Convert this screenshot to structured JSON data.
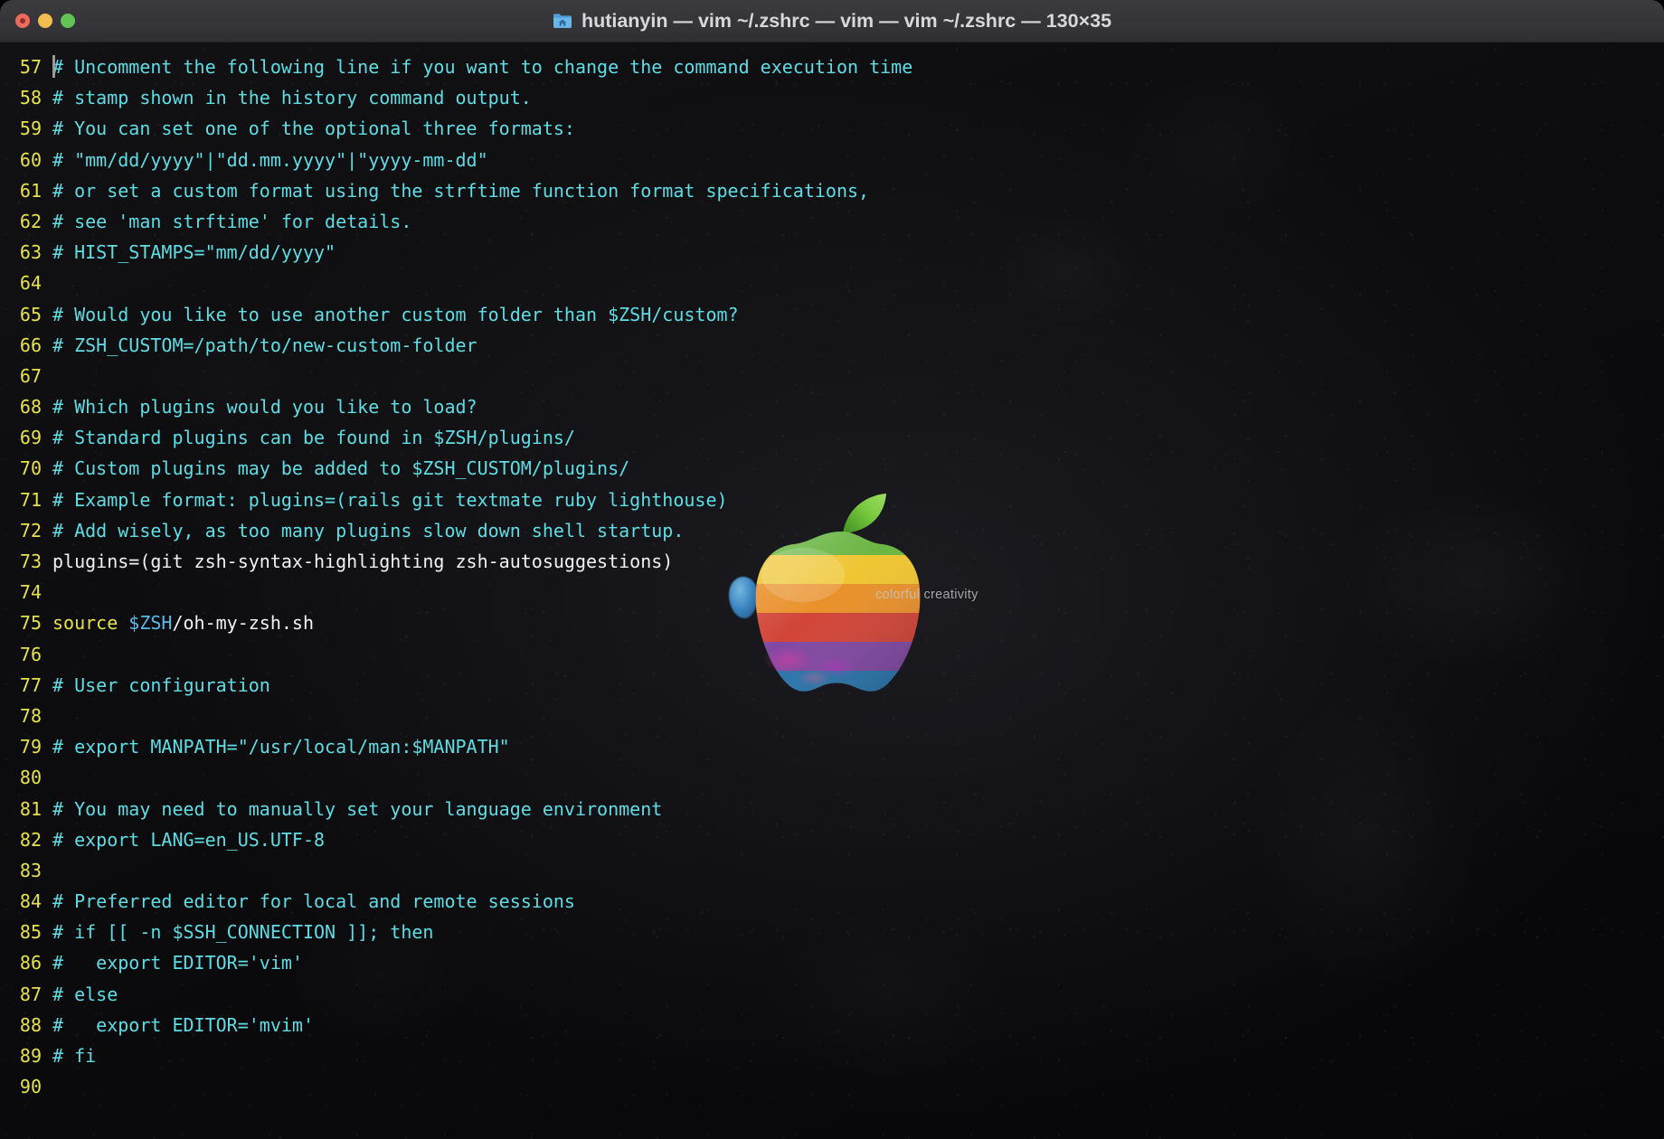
{
  "window": {
    "title": "hutianyin — vim ~/.zshrc — vim — vim ~/.zshrc — 130×35",
    "icon": "home-folder-icon",
    "traffic_lights": {
      "close_label": "Close",
      "minimize_label": "Minimize",
      "maximize_label": "Maximize",
      "close_color": "#ed6a5f",
      "minimize_color": "#f4bd4f",
      "maximize_color": "#61c454"
    }
  },
  "wallpaper": {
    "tagline": "colorful creativity",
    "logo": "apple-rainbow-logo",
    "background_color": "#0b0b0d",
    "stripe_colors": [
      "#63b23a",
      "#eec227",
      "#e88b20",
      "#cf3b2d",
      "#7b3f9e",
      "#1f6fa8"
    ]
  },
  "editor": {
    "app": "vim",
    "file": "~/.zshrc",
    "columns": 130,
    "rows": 35,
    "cursor": {
      "line": 57,
      "col": 1
    },
    "colors": {
      "line_number": "#e6e14f",
      "comment": "#5fdde5",
      "normal_text": "#f2f2f2",
      "keyword": "#e6e14f",
      "variable": "#5ab9e8",
      "cursor": "#9a9a9a"
    },
    "lines": [
      {
        "n": "57",
        "cursor": true,
        "spans": [
          {
            "c": "txt",
            "t": "# Uncomment the following line if you want to change the command execution time"
          }
        ]
      },
      {
        "n": "58",
        "spans": [
          {
            "c": "txt",
            "t": "# stamp shown in the history command output."
          }
        ]
      },
      {
        "n": "59",
        "spans": [
          {
            "c": "txt",
            "t": "# You can set one of the optional three formats:"
          }
        ]
      },
      {
        "n": "60",
        "spans": [
          {
            "c": "txt",
            "t": "# \"mm/dd/yyyy\"|\"dd.mm.yyyy\"|\"yyyy-mm-dd\""
          }
        ]
      },
      {
        "n": "61",
        "spans": [
          {
            "c": "txt",
            "t": "# or set a custom format using the strftime function format specifications,"
          }
        ]
      },
      {
        "n": "62",
        "spans": [
          {
            "c": "txt",
            "t": "# see 'man strftime' for details."
          }
        ]
      },
      {
        "n": "63",
        "spans": [
          {
            "c": "txt",
            "t": "# HIST_STAMPS=\"mm/dd/yyyy\""
          }
        ]
      },
      {
        "n": "64",
        "spans": []
      },
      {
        "n": "65",
        "spans": [
          {
            "c": "txt",
            "t": "# Would you like to use another custom folder than $ZSH/custom?"
          }
        ]
      },
      {
        "n": "66",
        "spans": [
          {
            "c": "txt",
            "t": "# ZSH_CUSTOM=/path/to/new-custom-folder"
          }
        ]
      },
      {
        "n": "67",
        "spans": []
      },
      {
        "n": "68",
        "spans": [
          {
            "c": "txt",
            "t": "# Which plugins would you like to load?"
          }
        ]
      },
      {
        "n": "69",
        "spans": [
          {
            "c": "txt",
            "t": "# Standard plugins can be found in $ZSH/plugins/"
          }
        ]
      },
      {
        "n": "70",
        "spans": [
          {
            "c": "txt",
            "t": "# Custom plugins may be added to $ZSH_CUSTOM/plugins/"
          }
        ]
      },
      {
        "n": "71",
        "spans": [
          {
            "c": "txt",
            "t": "# Example format: plugins=(rails git textmate ruby lighthouse)"
          }
        ]
      },
      {
        "n": "72",
        "spans": [
          {
            "c": "txt",
            "t": "# Add wisely, as too many plugins slow down shell startup."
          }
        ]
      },
      {
        "n": "73",
        "spans": [
          {
            "c": "plain",
            "t": "plugins=(git zsh-syntax-highlighting zsh-autosuggestions)"
          }
        ]
      },
      {
        "n": "74",
        "spans": []
      },
      {
        "n": "75",
        "spans": [
          {
            "c": "kw",
            "t": "source "
          },
          {
            "c": "var",
            "t": "$ZSH"
          },
          {
            "c": "plain",
            "t": "/oh-my-zsh.sh"
          }
        ]
      },
      {
        "n": "76",
        "spans": []
      },
      {
        "n": "77",
        "spans": [
          {
            "c": "txt",
            "t": "# User configuration"
          }
        ]
      },
      {
        "n": "78",
        "spans": []
      },
      {
        "n": "79",
        "spans": [
          {
            "c": "txt",
            "t": "# export MANPATH=\"/usr/local/man:$MANPATH\""
          }
        ]
      },
      {
        "n": "80",
        "spans": []
      },
      {
        "n": "81",
        "spans": [
          {
            "c": "txt",
            "t": "# You may need to manually set your language environment"
          }
        ]
      },
      {
        "n": "82",
        "spans": [
          {
            "c": "txt",
            "t": "# export LANG=en_US.UTF-8"
          }
        ]
      },
      {
        "n": "83",
        "spans": []
      },
      {
        "n": "84",
        "spans": [
          {
            "c": "txt",
            "t": "# Preferred editor for local and remote sessions"
          }
        ]
      },
      {
        "n": "85",
        "spans": [
          {
            "c": "txt",
            "t": "# if [[ -n $SSH_CONNECTION ]]; then"
          }
        ]
      },
      {
        "n": "86",
        "spans": [
          {
            "c": "txt",
            "t": "#   export EDITOR='vim'"
          }
        ]
      },
      {
        "n": "87",
        "spans": [
          {
            "c": "txt",
            "t": "# else"
          }
        ]
      },
      {
        "n": "88",
        "spans": [
          {
            "c": "txt",
            "t": "#   export EDITOR='mvim'"
          }
        ]
      },
      {
        "n": "89",
        "spans": [
          {
            "c": "txt",
            "t": "# fi"
          }
        ]
      },
      {
        "n": "90",
        "spans": []
      }
    ]
  }
}
